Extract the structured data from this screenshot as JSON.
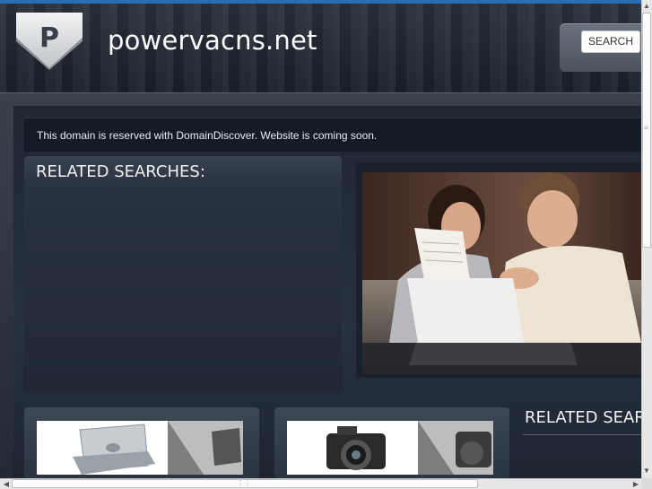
{
  "header": {
    "logo_letter": "P",
    "site_title": "powervacns.net",
    "search_label": "SEARCH"
  },
  "notice": {
    "text": "This domain is reserved with DomainDiscover. Website is coming soon."
  },
  "related": {
    "title": "RELATED SEARCHES:",
    "title_right": "RELATED SEARCHES:"
  },
  "images": {
    "hero": "couple-with-laptop-photo",
    "thumb1": "laptop-thumbnail",
    "thumb2": "camera-thumbnail"
  },
  "colors": {
    "accent_bar": "#2a6db5",
    "background": "#1b2330"
  }
}
